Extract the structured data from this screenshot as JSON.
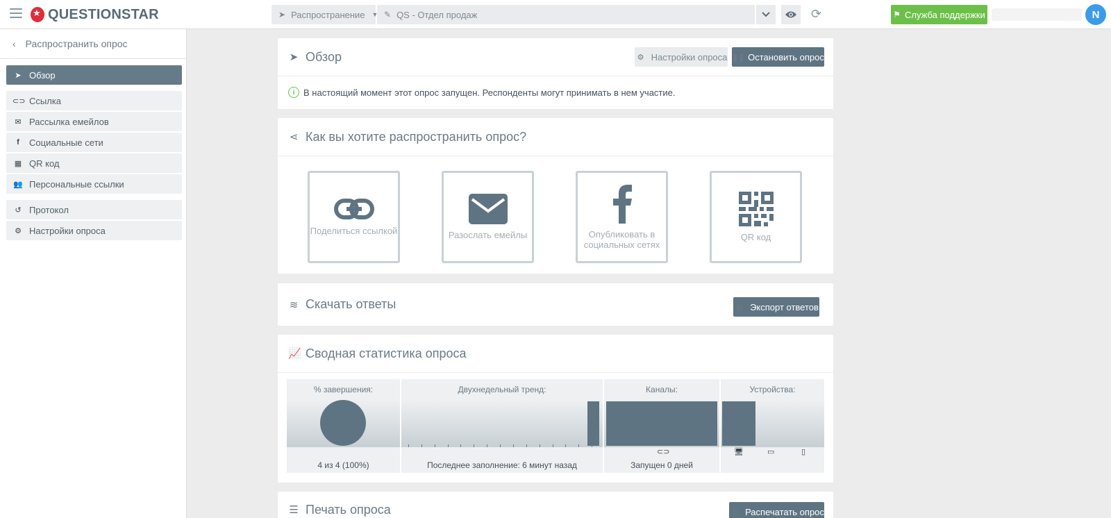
{
  "topbar": {
    "logo_text": "QUESTIONSTAR",
    "distribute_label": "Распространение",
    "survey_label": "QS - Отдел продаж",
    "support_label": "Служба поддержки",
    "avatar_initial": "N"
  },
  "sidebar": {
    "back_label": "Распространить опрос",
    "items": [
      {
        "label": "Обзор",
        "icon": "paper-plane-icon",
        "active": true
      },
      {
        "label": "Ссылка",
        "icon": "link-icon"
      },
      {
        "label": "Рассылка емейлов",
        "icon": "envelope-icon"
      },
      {
        "label": "Социальные сети",
        "icon": "facebook-icon"
      },
      {
        "label": "QR код",
        "icon": "qr-code-icon"
      },
      {
        "label": "Персональные ссылки",
        "icon": "users-icon"
      },
      {
        "label": "Протокол",
        "icon": "history-icon"
      },
      {
        "label": "Настройки опроса",
        "icon": "gear-icon"
      }
    ]
  },
  "overview": {
    "title": "Обзор",
    "settings_btn": "Настройки опроса",
    "stop_btn": "Остановить опрос",
    "status_msg": "В настоящий момент этот опрос запущен. Респонденты могут принимать в нем участие."
  },
  "distribute": {
    "title": "Как вы хотите распространить опрос?",
    "tiles": [
      {
        "label": "Поделиться ссылкой",
        "icon": "link-icon"
      },
      {
        "label": "Разослать емейлы",
        "icon": "envelope-icon"
      },
      {
        "label": "Опубликовать в социальных сетях",
        "icon": "facebook-icon"
      },
      {
        "label": "QR код",
        "icon": "qr-code-icon"
      }
    ]
  },
  "download": {
    "title": "Скачать ответы",
    "export_btn": "Экспорт ответов"
  },
  "stats": {
    "title": "Сводная статистика опроса",
    "completion_head": "% завершения:",
    "completion_value": "4 из 4 (100%)",
    "completion_fraction": 1.0,
    "trend_head": "Двухнедельный тренд:",
    "trend_foot": "Последнее заполнение: 6 минут назад",
    "trend_values": [
      0,
      0,
      0,
      0,
      0,
      0,
      0,
      0,
      0,
      0,
      0,
      0,
      0,
      0,
      4
    ],
    "channels_head": "Каналы:",
    "channels_foot": "Запущен 0 дней",
    "channels_values": [
      4
    ],
    "devices_head": "Устройства:",
    "devices_values": [
      4,
      0,
      0
    ],
    "devices_icons": [
      "desktop-icon",
      "tablet-icon",
      "mobile-icon"
    ]
  },
  "print": {
    "title": "Печать опроса",
    "print_btn": "Распечатать опрос"
  },
  "colors": {
    "accent": "#5f7482",
    "support_green": "#6cc04a",
    "avatar_blue": "#3c9be8",
    "logo_red": "#e02d3c"
  }
}
